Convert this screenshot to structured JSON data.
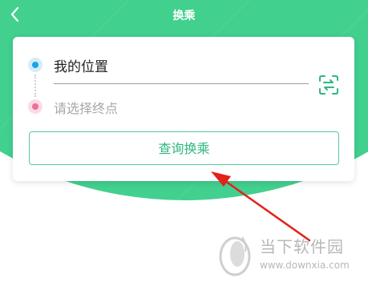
{
  "header": {
    "title": "换乘",
    "back_icon": "chevron-left-icon"
  },
  "route_card": {
    "from_value": "我的位置",
    "to_placeholder": "请选择终点",
    "swap_icon": "swap-direction-icon",
    "query_button_label": "查询换乘"
  },
  "watermark": {
    "brand": "当下软件园",
    "url": "www.downxia.com"
  },
  "colors": {
    "primary": "#42d08f",
    "button_text": "#2fb77f",
    "start_dot": "#1aa3ea",
    "end_dot": "#ef6e9a",
    "annotation_arrow": "#e2221b"
  }
}
